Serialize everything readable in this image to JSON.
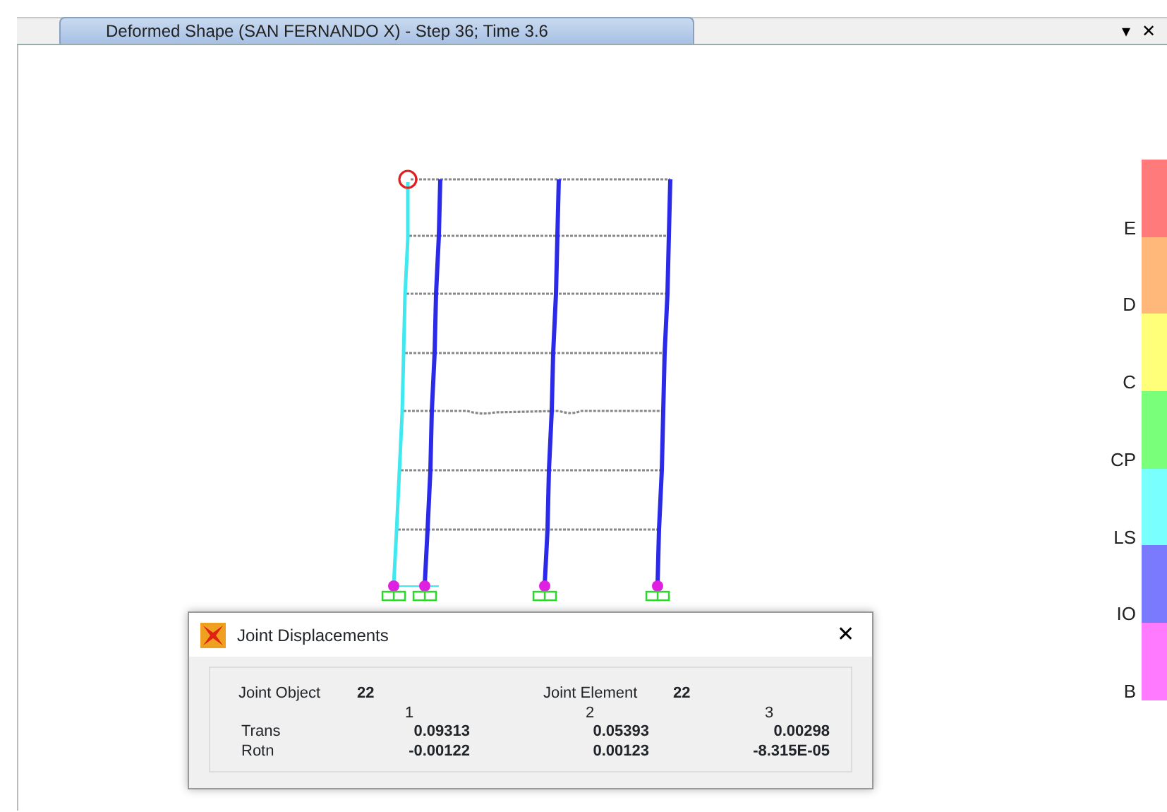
{
  "window": {
    "title": "Deformed Shape (SAN FERNANDO X) - Step 36; Time 3.6",
    "menu_glyph": "▾",
    "close_glyph": "✕"
  },
  "legend": [
    {
      "label": "E",
      "color": "#ff7a7a"
    },
    {
      "label": "D",
      "color": "#ffb87a"
    },
    {
      "label": "C",
      "color": "#ffff7a"
    },
    {
      "label": "CP",
      "color": "#7aff7a"
    },
    {
      "label": "LS",
      "color": "#7affff"
    },
    {
      "label": "IO",
      "color": "#7a7aff"
    },
    {
      "label": "B",
      "color": "#ff7aff"
    }
  ],
  "dialog": {
    "title": "Joint Displacements",
    "close_glyph": "✕",
    "joint_object_label": "Joint  Object",
    "joint_object": "22",
    "joint_element_label": "Joint Element",
    "joint_element": "22",
    "columns": [
      "1",
      "2",
      "3"
    ],
    "rows": [
      {
        "label": "Trans",
        "values": [
          "0.09313",
          "0.05393",
          "0.00298"
        ]
      },
      {
        "label": "Rotn",
        "values": [
          "-0.00122",
          "0.00123",
          "-8.315E-05"
        ]
      }
    ]
  }
}
